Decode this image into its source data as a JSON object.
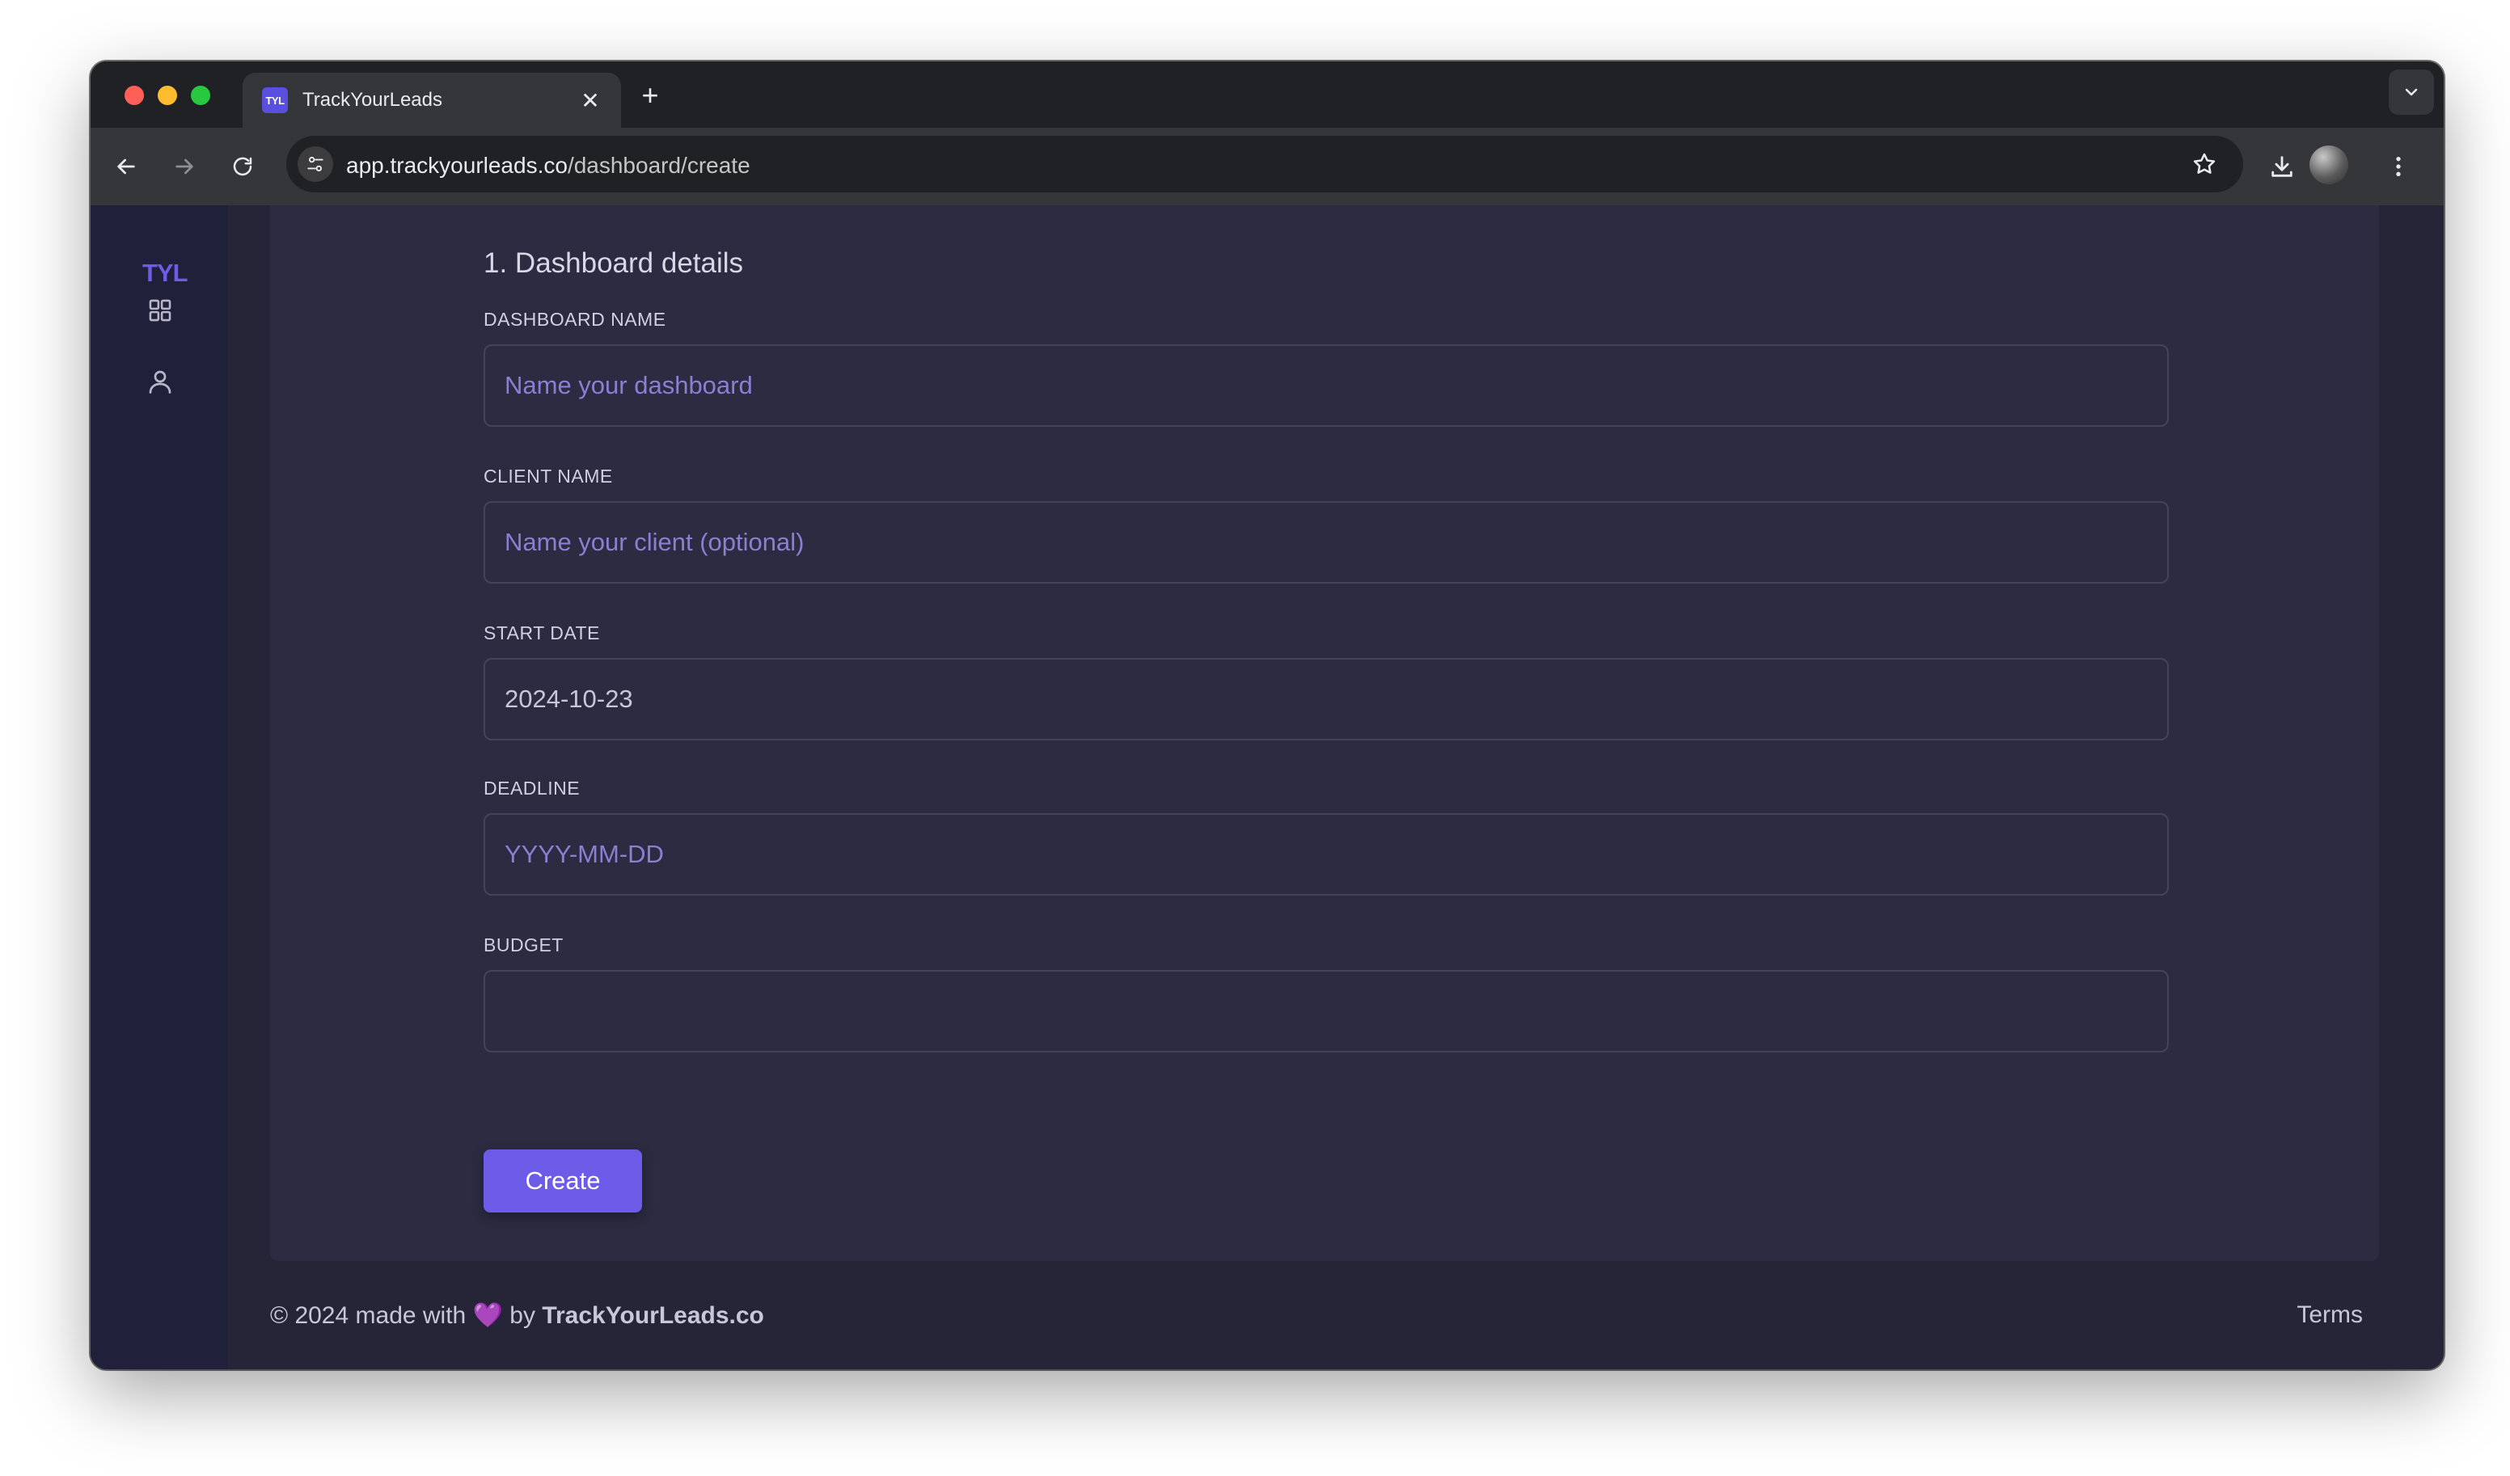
{
  "browser": {
    "tab_title": "TrackYourLeads",
    "tab_favicon_text": "TYL",
    "url_host": "app.trackyourleads.co",
    "url_path": "/dashboard/create"
  },
  "sidebar": {
    "logo": "TYL",
    "items": [
      {
        "icon": "grid-icon"
      },
      {
        "icon": "user-icon"
      }
    ]
  },
  "form": {
    "section_title": "1. Dashboard details",
    "fields": [
      {
        "label": "DASHBOARD NAME",
        "value": "",
        "placeholder": "Name your dashboard"
      },
      {
        "label": "CLIENT NAME",
        "value": "",
        "placeholder": "Name your client (optional)"
      },
      {
        "label": "START DATE",
        "value": "2024-10-23",
        "placeholder": ""
      },
      {
        "label": "DEADLINE",
        "value": "",
        "placeholder": "YYYY-MM-DD"
      },
      {
        "label": "BUDGET",
        "value": "",
        "placeholder": ""
      }
    ],
    "submit_label": "Create"
  },
  "footer": {
    "prefix": "© 2024 made with",
    "heart": "💜",
    "by": "by",
    "brand": "TrackYourLeads.co",
    "terms": "Terms"
  },
  "colors": {
    "accent": "#6c5ce7",
    "page_bg": "#262537",
    "card_bg": "#2c2b41",
    "sidebar_bg": "#21203a"
  }
}
